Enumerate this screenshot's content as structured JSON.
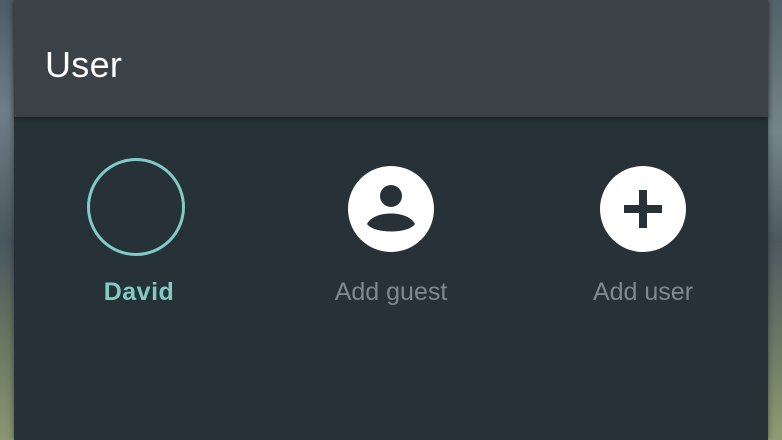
{
  "header": {
    "title": "User"
  },
  "users": [
    {
      "label": "David",
      "icon": "avatar-ring",
      "active": true
    },
    {
      "label": "Add guest",
      "icon": "person-icon",
      "active": false
    },
    {
      "label": "Add user",
      "icon": "plus-icon",
      "active": false
    }
  ],
  "colors": {
    "panel_bg": "#263238",
    "header_bg": "#3a4248",
    "accent": "#80cbc4",
    "inactive_text": "#7f8a90"
  }
}
